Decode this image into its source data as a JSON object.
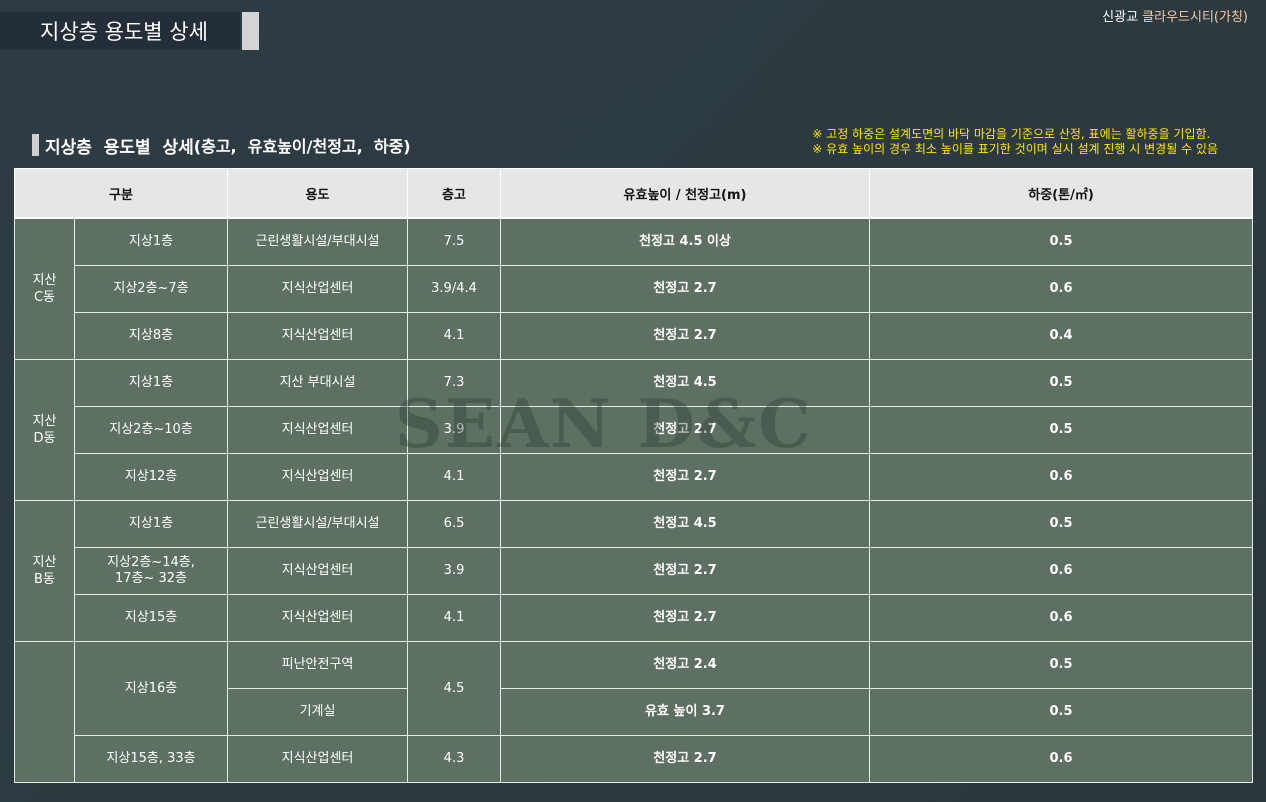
{
  "header": {
    "page_title": "지상층 용도별 상세",
    "brand_prefix": "신광교 ",
    "brand_name": "클라우드시티(가칭)"
  },
  "section": {
    "title": "지상층  용도별  상세",
    "title_paren": "(층고,  유효높이/천정고,  하중)",
    "notes": [
      "※ 고정 하중은 설계도면의 바닥 마감을 기준으로 산정, 표에는 활하중을 기입함.",
      "※ 유효 높이의 경우 최소 높이를 표기한 것이며 실시 설계 진행 시 변경될 수 있음"
    ]
  },
  "watermark": "SEAN D&C",
  "table": {
    "headers": [
      "구분",
      "용도",
      "층고",
      "유효높이 / 천정고(m)",
      "하중(톤/㎡)"
    ],
    "groups": [
      {
        "line1": "지산",
        "line2": "C동"
      },
      {
        "line1": "지산",
        "line2": "D동"
      },
      {
        "line1": "지산",
        "line2": "B동"
      },
      {
        "line1": "",
        "line2": ""
      }
    ],
    "rows": [
      {
        "floor": "지상1층",
        "use": "근린생활시설/부대시설",
        "height": "7.5",
        "ceiling": "천정고 4.5 이상",
        "load": "0.5"
      },
      {
        "floor": "지상2층~7층",
        "use": "지식산업센터",
        "height": "3.9/4.4",
        "ceiling": "천정고 2.7",
        "load": "0.6"
      },
      {
        "floor": "지상8층",
        "use": "지식산업센터",
        "height": "4.1",
        "ceiling": "천정고 2.7",
        "load": "0.4"
      },
      {
        "floor": "지상1층",
        "use": "지산 부대시설",
        "height": "7.3",
        "ceiling": "천정고 4.5",
        "load": "0.5"
      },
      {
        "floor": "지상2층~10층",
        "use": "지식산업센터",
        "height": "3.9",
        "ceiling": "천정고 2.7",
        "load": "0.5"
      },
      {
        "floor": "지상12층",
        "use": "지식산업센터",
        "height": "4.1",
        "ceiling": "천정고 2.7",
        "load": "0.6"
      },
      {
        "floor": "지상1층",
        "use": "근린생활시설/부대시설",
        "height": "6.5",
        "ceiling": "천정고 4.5",
        "load": "0.5"
      },
      {
        "floor_line1": "지상2층~14층,",
        "floor_line2": "17층~ 32층",
        "use": "지식산업센터",
        "height": "3.9",
        "ceiling": "천정고 2.7",
        "load": "0.6"
      },
      {
        "floor": "지상15층",
        "use": "지식산업센터",
        "height": "4.1",
        "ceiling": "천정고 2.7",
        "load": "0.6"
      },
      {
        "floor": "지상16층",
        "use": "피난안전구역",
        "height": "4.5",
        "ceiling": "천정고 2.4",
        "load": "0.5"
      },
      {
        "use": "기계실",
        "ceiling": "유효 높이 3.7",
        "load": "0.5"
      },
      {
        "floor": "지상15층, 33층",
        "use": "지식산업센터",
        "height": "4.3",
        "ceiling": "천정고 2.7",
        "load": "0.6"
      }
    ]
  }
}
